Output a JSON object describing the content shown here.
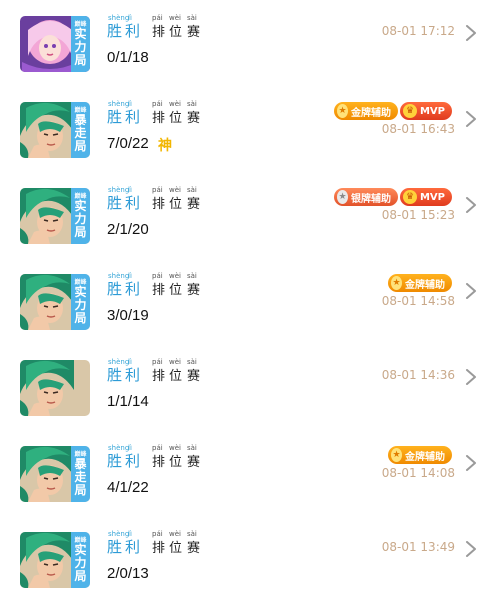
{
  "matches": [
    {
      "mode_top": "实",
      "mode_mid": "力",
      "mode_bot": "局",
      "mode_tiny": "巅峰",
      "mode_color": "#4fb3e9",
      "hero": "pink",
      "result_pinyin": [
        "shèng",
        "lì",
        "pái",
        "wèi",
        "sài"
      ],
      "result_chars": [
        "胜",
        "利",
        "排",
        "位",
        "赛"
      ],
      "kda": "0/1/18",
      "god": "",
      "badges": [],
      "time": "08-01 17:12"
    },
    {
      "mode_top": "暴",
      "mode_mid": "走",
      "mode_bot": "局",
      "mode_tiny": "巅峰",
      "mode_color": "#4fb3e9",
      "hero": "green",
      "result_pinyin": [
        "shèng",
        "lì",
        "pái",
        "wèi",
        "sài"
      ],
      "result_chars": [
        "胜",
        "利",
        "排",
        "位",
        "赛"
      ],
      "kda": "7/0/22",
      "god": "神",
      "badges": [
        {
          "type": "gold",
          "label": "金牌辅助"
        },
        {
          "type": "mvp",
          "label": "MVP"
        }
      ],
      "time": "08-01 16:43"
    },
    {
      "mode_top": "实",
      "mode_mid": "力",
      "mode_bot": "局",
      "mode_tiny": "巅峰",
      "mode_color": "#4fb3e9",
      "hero": "green",
      "result_pinyin": [
        "shèng",
        "lì",
        "pái",
        "wèi",
        "sài"
      ],
      "result_chars": [
        "胜",
        "利",
        "排",
        "位",
        "赛"
      ],
      "kda": "2/1/20",
      "god": "",
      "badges": [
        {
          "type": "silver",
          "label": "银牌辅助"
        },
        {
          "type": "mvp",
          "label": "MVP"
        }
      ],
      "time": "08-01 15:23"
    },
    {
      "mode_top": "实",
      "mode_mid": "力",
      "mode_bot": "局",
      "mode_tiny": "巅峰",
      "mode_color": "#4fb3e9",
      "hero": "green",
      "result_pinyin": [
        "shèng",
        "lì",
        "pái",
        "wèi",
        "sài"
      ],
      "result_chars": [
        "胜",
        "利",
        "排",
        "位",
        "赛"
      ],
      "kda": "3/0/19",
      "god": "",
      "badges": [
        {
          "type": "gold",
          "label": "金牌辅助"
        }
      ],
      "time": "08-01 14:58"
    },
    {
      "mode_top": "",
      "mode_mid": "",
      "mode_bot": "",
      "mode_tiny": "",
      "mode_color": "",
      "hero": "green",
      "result_pinyin": [
        "shèng",
        "lì",
        "pái",
        "wèi",
        "sài"
      ],
      "result_chars": [
        "胜",
        "利",
        "排",
        "位",
        "赛"
      ],
      "kda": "1/1/14",
      "god": "",
      "badges": [],
      "time": "08-01 14:36"
    },
    {
      "mode_top": "暴",
      "mode_mid": "走",
      "mode_bot": "局",
      "mode_tiny": "巅峰",
      "mode_color": "#4fb3e9",
      "hero": "green",
      "result_pinyin": [
        "shèng",
        "lì",
        "pái",
        "wèi",
        "sài"
      ],
      "result_chars": [
        "胜",
        "利",
        "排",
        "位",
        "赛"
      ],
      "kda": "4/1/22",
      "god": "",
      "badges": [
        {
          "type": "gold",
          "label": "金牌辅助"
        }
      ],
      "time": "08-01 14:08"
    },
    {
      "mode_top": "实",
      "mode_mid": "力",
      "mode_bot": "局",
      "mode_tiny": "巅峰",
      "mode_color": "#4fb3e9",
      "hero": "green",
      "result_pinyin": [
        "shèng",
        "lì",
        "pái",
        "wèi",
        "sài"
      ],
      "result_chars": [
        "胜",
        "利",
        "排",
        "位",
        "赛"
      ],
      "kda": "2/0/13",
      "god": "",
      "badges": [],
      "time": "08-01 13:49"
    }
  ],
  "icons": {
    "chevron": "chevron-right-icon",
    "gold_badge_icon": "star-icon",
    "mvp_badge_icon": "trophy-icon"
  },
  "colors": {
    "win_text": "#2d9bd6",
    "time_text": "#c9a98a",
    "gold_badge": "#f5a10a",
    "mvp_badge": "#e8482a",
    "god_tag": "#f2b600"
  }
}
